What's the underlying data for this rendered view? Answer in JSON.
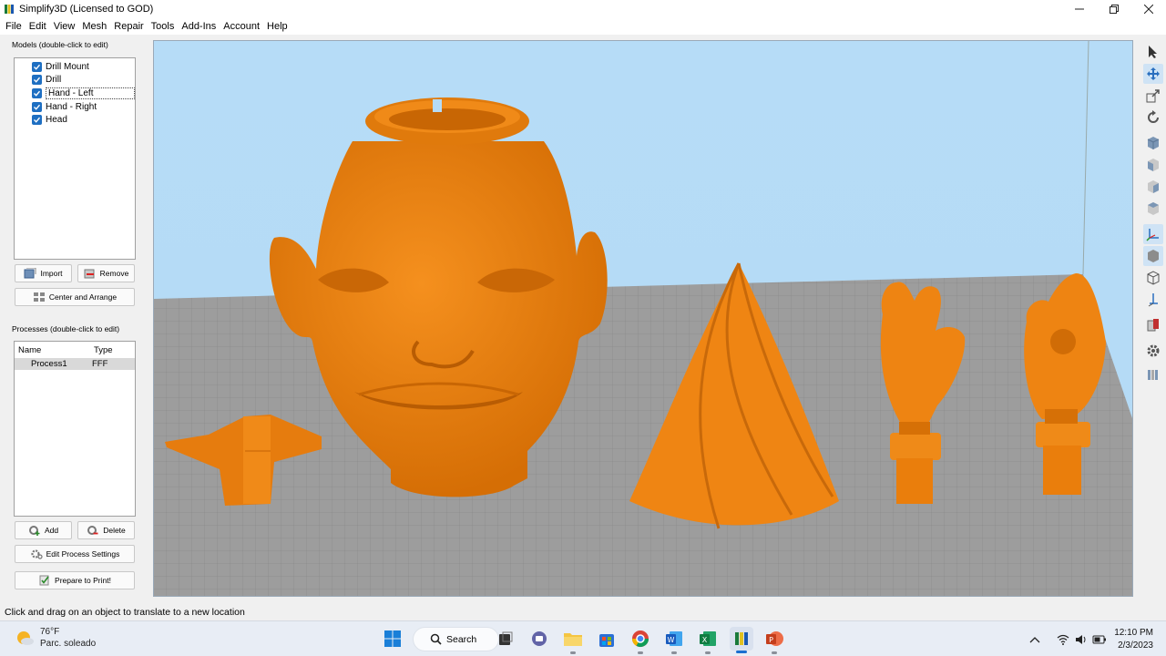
{
  "window": {
    "title": "Simplify3D (Licensed to GOD)",
    "controls": [
      "minimize",
      "maximize",
      "close"
    ]
  },
  "menu": [
    "File",
    "Edit",
    "View",
    "Mesh",
    "Repair",
    "Tools",
    "Add-Ins",
    "Account",
    "Help"
  ],
  "models": {
    "label": "Models (double-click to edit)",
    "items": [
      {
        "name": "Drill Mount",
        "checked": true
      },
      {
        "name": "Drill",
        "checked": true
      },
      {
        "name": "Hand - Left",
        "checked": true,
        "selected": true
      },
      {
        "name": "Hand - Right",
        "checked": true
      },
      {
        "name": "Head",
        "checked": true
      }
    ],
    "import_label": "Import",
    "remove_label": "Remove",
    "center_label": "Center and Arrange"
  },
  "processes": {
    "label": "Processes (double-click to edit)",
    "col_name": "Name",
    "col_type": "Type",
    "rows": [
      {
        "name": "Process1",
        "type": "FFF"
      }
    ],
    "add_label": "Add",
    "delete_label": "Delete",
    "edit_label": "Edit Process Settings",
    "prepare_label": "Prepare to Print!"
  },
  "viewport": {
    "colors": {
      "sky": "#b5dbf6",
      "bed": "#9c9c9c",
      "model": "#f08413"
    }
  },
  "right_toolbar": [
    "select-icon",
    "move-icon",
    "scale-icon",
    "rotate-icon",
    "view-default-icon",
    "view-front-icon",
    "view-side-icon",
    "view-top-icon",
    "axes-icon",
    "cube-icon",
    "wireframe-icon",
    "cut-plane-icon",
    "cross-section-icon",
    "settings-icon",
    "layers-icon"
  ],
  "status": "Click and drag on an object to translate to a new location",
  "taskbar": {
    "weather_temp": "76°F",
    "weather_desc": "Parc. soleado",
    "search_label": "Search",
    "time": "12:10 PM",
    "date": "2/3/2023"
  }
}
